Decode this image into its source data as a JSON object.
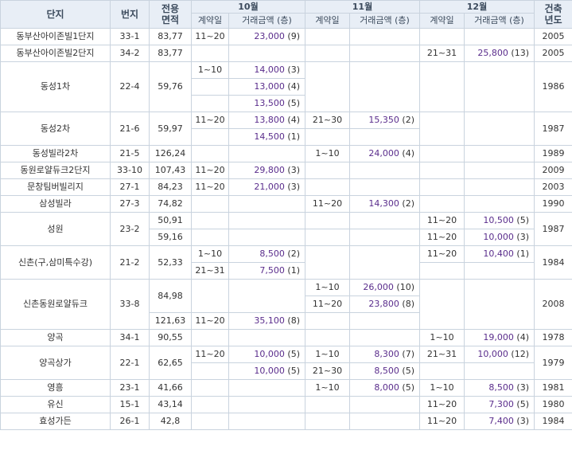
{
  "headers": {
    "complex": "단지",
    "lot": "번지",
    "area": "전용면적",
    "built": "건축년도",
    "months": [
      "10월",
      "11월",
      "12월"
    ],
    "contract_day": "계약일",
    "amount": "거래금액 (층)"
  },
  "rows": {
    "r1": {
      "name": "동부산아이존빌1단지",
      "lot": "33-1",
      "area": "83,77",
      "year": "2005",
      "oct_day": "11~20",
      "oct_amt": "23,000",
      "oct_floor": "(9)"
    },
    "r2": {
      "name": "동부산아이존빌2단지",
      "lot": "34-2",
      "area": "83,77",
      "year": "2005",
      "dec_day": "21~31",
      "dec_amt": "25,800",
      "dec_floor": "(13)"
    },
    "r3": {
      "name": "동성1차",
      "lot": "22-4",
      "area": "59,76",
      "year": "1986",
      "oct_day": "1~10",
      "oct": [
        {
          "amt": "14,000",
          "floor": "(3)"
        },
        {
          "amt": "13,000",
          "floor": "(4)"
        },
        {
          "amt": "13,500",
          "floor": "(5)"
        }
      ]
    },
    "r4": {
      "name": "동성2차",
      "lot": "21-6",
      "area": "59,97",
      "year": "1987",
      "oct_day": "11~20",
      "oct": [
        {
          "amt": "13,800",
          "floor": "(4)"
        },
        {
          "amt": "14,500",
          "floor": "(1)"
        }
      ],
      "nov_day": "21~30",
      "nov_amt": "15,350",
      "nov_floor": "(2)"
    },
    "r5": {
      "name": "동성빌라2차",
      "lot": "21-5",
      "area": "126,24",
      "year": "1989",
      "nov_day": "1~10",
      "nov_amt": "24,000",
      "nov_floor": "(4)"
    },
    "r6": {
      "name": "동원로얄듀크2단지",
      "lot": "33-10",
      "area": "107,43",
      "year": "2009",
      "oct_day": "11~20",
      "oct_amt": "29,800",
      "oct_floor": "(3)"
    },
    "r7": {
      "name": "문창팀버빌리지",
      "lot": "27-1",
      "area": "84,23",
      "year": "2003",
      "oct_day": "11~20",
      "oct_amt": "21,000",
      "oct_floor": "(3)"
    },
    "r8": {
      "name": "삼성빌라",
      "lot": "27-3",
      "area": "74,82",
      "year": "1990",
      "nov_day": "11~20",
      "nov_amt": "14,300",
      "nov_floor": "(2)"
    },
    "r9": {
      "name": "성원",
      "lot": "23-2",
      "year": "1987",
      "a": {
        "area": "50,91",
        "dec_day": "11~20",
        "dec_amt": "10,500",
        "dec_floor": "(5)"
      },
      "b": {
        "area": "59,16",
        "dec_day": "11~20",
        "dec_amt": "10,000",
        "dec_floor": "(3)"
      }
    },
    "r10": {
      "name": "신촌(구,삼미특수강)",
      "lot": "21-2",
      "area": "52,33",
      "year": "1984",
      "oct": [
        {
          "day": "1~10",
          "amt": "8,500",
          "floor": "(2)"
        },
        {
          "day": "21~31",
          "amt": "7,500",
          "floor": "(1)"
        }
      ],
      "dec_day": "11~20",
      "dec_amt": "10,400",
      "dec_floor": "(1)"
    },
    "r11": {
      "name": "신촌동원로얄듀크",
      "lot": "33-8",
      "year": "2008",
      "a": {
        "area": "84,98",
        "nov": [
          {
            "day": "1~10",
            "amt": "26,000",
            "floor": "(10)"
          },
          {
            "day": "11~20",
            "amt": "23,800",
            "floor": "(8)"
          }
        ]
      },
      "b": {
        "area": "121,63",
        "oct_day": "11~20",
        "oct_amt": "35,100",
        "oct_floor": "(8)"
      }
    },
    "r12": {
      "name": "양곡",
      "lot": "34-1",
      "area": "90,55",
      "year": "1978",
      "dec_day": "1~10",
      "dec_amt": "19,000",
      "dec_floor": "(4)"
    },
    "r13": {
      "name": "양곡상가",
      "lot": "22-1",
      "area": "62,65",
      "year": "1979",
      "oct_day": "11~20",
      "oct": [
        {
          "amt": "10,000",
          "floor": "(5)"
        },
        {
          "amt": "10,000",
          "floor": "(5)"
        }
      ],
      "nov": [
        {
          "day": "1~10",
          "amt": "8,300",
          "floor": "(7)"
        },
        {
          "day": "21~30",
          "amt": "8,500",
          "floor": "(5)"
        }
      ],
      "dec_day": "21~31",
      "dec_amt": "10,000",
      "dec_floor": "(12)"
    },
    "r14": {
      "name": "영흥",
      "lot": "23-1",
      "area": "41,66",
      "year": "1981",
      "nov_day": "1~10",
      "nov_amt": "8,000",
      "nov_floor": "(5)",
      "dec_day": "1~10",
      "dec_amt": "8,500",
      "dec_floor": "(3)"
    },
    "r15": {
      "name": "유신",
      "lot": "15-1",
      "area": "43,14",
      "year": "1980",
      "dec_day": "11~20",
      "dec_amt": "7,300",
      "dec_floor": "(5)"
    },
    "r16": {
      "name": "효성가든",
      "lot": "26-1",
      "area": "42,8",
      "year": "1984",
      "dec_day": "11~20",
      "dec_amt": "7,400",
      "dec_floor": "(3)"
    }
  },
  "colors": {
    "header_bg": "#e8eef6",
    "border": "#c9d3de",
    "price": "#5a2d8c"
  }
}
